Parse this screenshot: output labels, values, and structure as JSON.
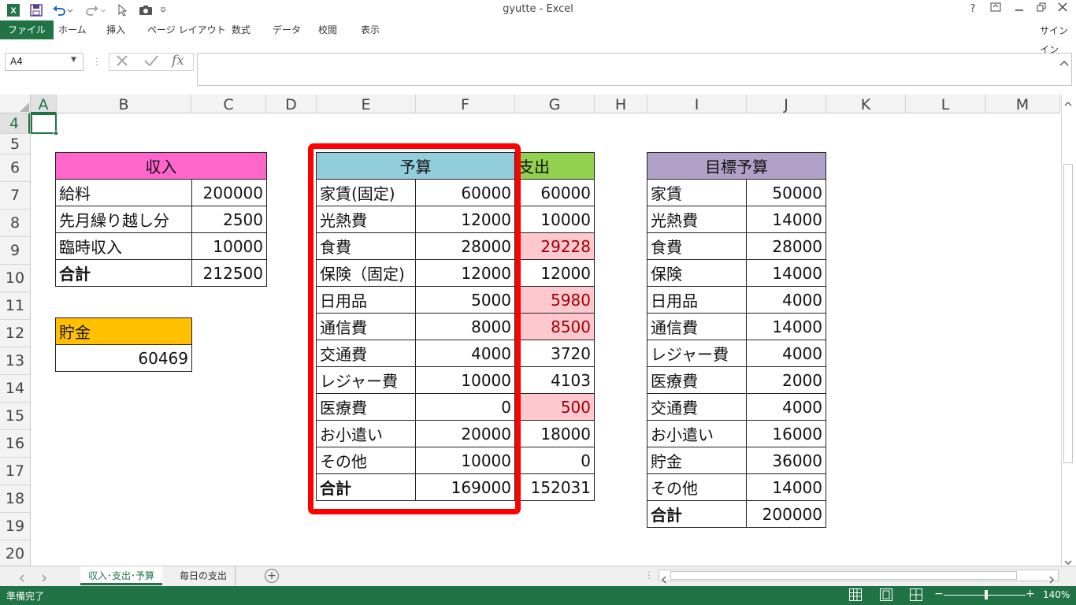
{
  "window": {
    "title": "gyutte - Excel",
    "help": "?",
    "signin": "サインイン"
  },
  "ribbon": {
    "tabs": [
      "ファイル",
      "ホーム",
      "挿入",
      "ページ レイアウト",
      "数式",
      "データ",
      "校閲",
      "表示"
    ]
  },
  "formula_bar": {
    "name_box": "A4",
    "fx": "fx",
    "value": ""
  },
  "grid": {
    "columns": [
      "A",
      "B",
      "C",
      "D",
      "E",
      "F",
      "G",
      "H",
      "I",
      "J",
      "K",
      "L",
      "M"
    ],
    "rows": [
      "4",
      "5",
      "6",
      "7",
      "8",
      "9",
      "10",
      "11",
      "12",
      "13",
      "14",
      "15",
      "16",
      "17",
      "18",
      "19",
      "20"
    ],
    "selected_cell": "A4"
  },
  "income": {
    "header": "収入",
    "rows": [
      {
        "label": "給料",
        "value": "200000"
      },
      {
        "label": "先月繰り越し分",
        "value": "2500"
      },
      {
        "label": "臨時収入",
        "value": "10000"
      },
      {
        "label": "合計",
        "value": "212500",
        "bold": true
      }
    ]
  },
  "savings": {
    "header": "貯金",
    "value": "60469"
  },
  "budget": {
    "header_budget": "予算",
    "header_spent": "支出",
    "rows": [
      {
        "label": "家賃(固定)",
        "budget": "60000",
        "spent": "60000",
        "over": false
      },
      {
        "label": "光熱費",
        "budget": "12000",
        "spent": "10000",
        "over": false
      },
      {
        "label": "食費",
        "budget": "28000",
        "spent": "29228",
        "over": true
      },
      {
        "label": "保険（固定)",
        "budget": "12000",
        "spent": "12000",
        "over": false
      },
      {
        "label": "日用品",
        "budget": "5000",
        "spent": "5980",
        "over": true
      },
      {
        "label": "通信費",
        "budget": "8000",
        "spent": "8500",
        "over": true
      },
      {
        "label": "交通費",
        "budget": "4000",
        "spent": "3720",
        "over": false
      },
      {
        "label": "レジャー費",
        "budget": "10000",
        "spent": "4103",
        "over": false
      },
      {
        "label": "医療費",
        "budget": "0",
        "spent": "500",
        "over": true
      },
      {
        "label": "お小遣い",
        "budget": "20000",
        "spent": "18000",
        "over": false
      },
      {
        "label": "その他",
        "budget": "10000",
        "spent": "0",
        "over": false
      },
      {
        "label": "合計",
        "budget": "169000",
        "spent": "152031",
        "over": false,
        "bold": true
      }
    ]
  },
  "target": {
    "header": "目標予算",
    "rows": [
      {
        "label": "家賃",
        "value": "50000"
      },
      {
        "label": "光熱費",
        "value": "14000"
      },
      {
        "label": "食費",
        "value": "28000"
      },
      {
        "label": "保険",
        "value": "14000"
      },
      {
        "label": "日用品",
        "value": "4000"
      },
      {
        "label": "通信費",
        "value": "14000"
      },
      {
        "label": "レジャー費",
        "value": "4000"
      },
      {
        "label": "医療費",
        "value": "2000"
      },
      {
        "label": "交通費",
        "value": "4000"
      },
      {
        "label": "お小遣い",
        "value": "16000"
      },
      {
        "label": "貯金",
        "value": "36000"
      },
      {
        "label": "その他",
        "value": "14000"
      },
      {
        "label": "合計",
        "value": "200000",
        "bold": true
      }
    ]
  },
  "sheets": {
    "tabs": [
      "収入･支出･予算",
      "毎日の支出"
    ],
    "active": 0,
    "add": "+"
  },
  "status": {
    "text": "準備完了",
    "zoom": "140%",
    "minus": "−",
    "plus": "+"
  },
  "colors": {
    "excel_green": "#217346",
    "income_header": "#ff66cc",
    "savings_header": "#ffc000",
    "budget_header": "#92cddc",
    "spent_header": "#92d050",
    "target_header": "#b1a0c7",
    "over_budget_fill": "#ffc7ce",
    "over_budget_text": "#9c0006",
    "highlight_frame": "#ff0000"
  }
}
